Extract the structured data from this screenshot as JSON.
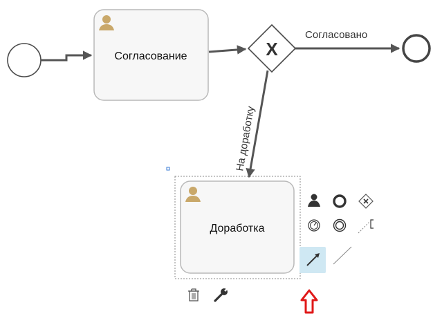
{
  "diagram": {
    "tasks": [
      {
        "id": "task-1",
        "label": "Согласование",
        "icon": "user-icon"
      },
      {
        "id": "task-2",
        "label": "Доработка",
        "icon": "user-icon"
      }
    ],
    "gateway": {
      "id": "exclusive-gateway",
      "marker": "X",
      "icon": "exclusive-gateway-icon"
    },
    "flows": [
      {
        "label": "Согласовано"
      },
      {
        "label": "На доработку"
      }
    ]
  },
  "context_pad": {
    "tools": [
      {
        "name": "append-user-task",
        "icon": "user-icon"
      },
      {
        "name": "append-end-event",
        "icon": "end-event-circle-icon"
      },
      {
        "name": "append-gateway",
        "icon": "gateway-diamond-icon"
      },
      {
        "name": "append-timer-event",
        "icon": "timer-event-icon"
      },
      {
        "name": "append-intermediate-event",
        "icon": "intermediate-event-icon"
      },
      {
        "name": "text-annotation",
        "icon": "annotation-icon"
      },
      {
        "name": "connect",
        "icon": "connect-arrow-icon",
        "selected": true
      },
      {
        "name": "association",
        "icon": "association-line-icon"
      },
      {
        "name": "delete",
        "icon": "trash-icon"
      },
      {
        "name": "properties",
        "icon": "wrench-icon"
      }
    ]
  },
  "pointer": {
    "icon": "up-arrow-icon",
    "color": "#e01818"
  },
  "colors": {
    "user_icon": "#c9a86a",
    "flow": "#555555",
    "selection": "#cfe8f3"
  }
}
